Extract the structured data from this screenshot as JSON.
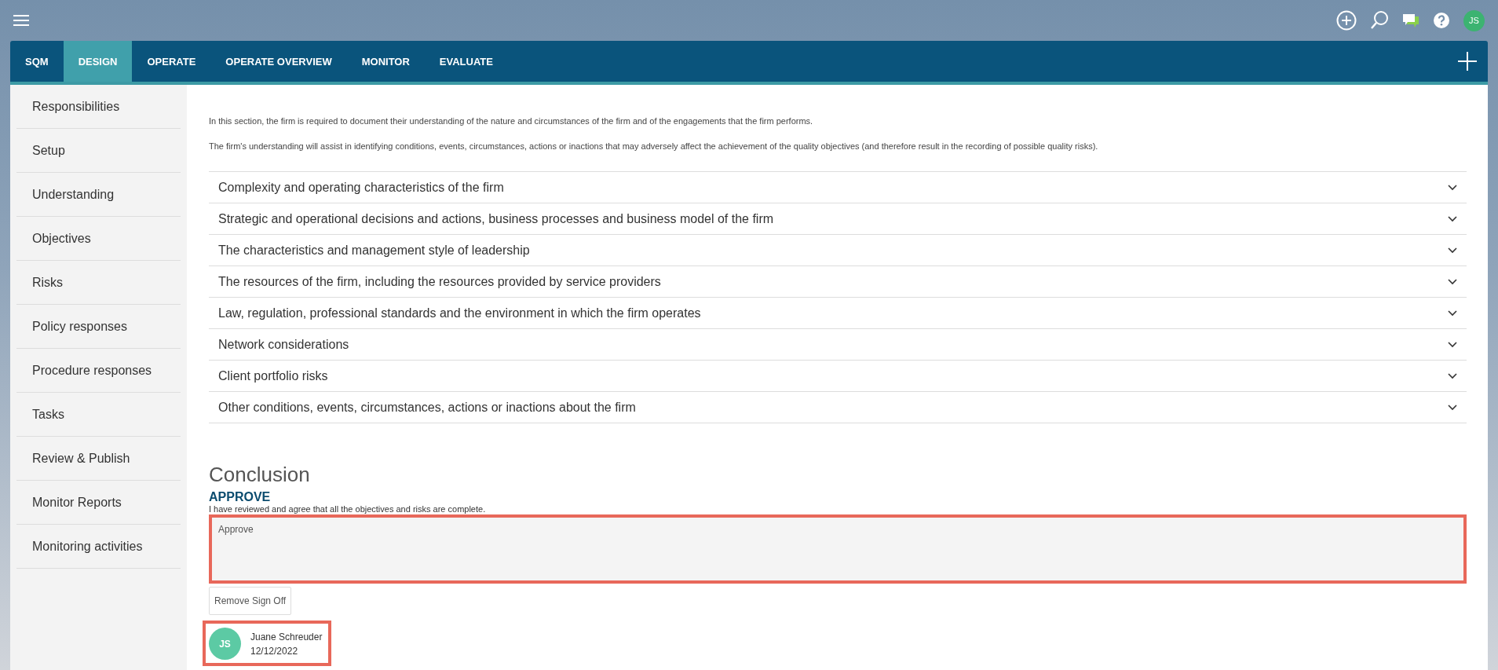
{
  "header": {
    "user_initials": "JS"
  },
  "tabs": [
    {
      "label": "SQM",
      "selected": false
    },
    {
      "label": "DESIGN",
      "selected": true
    },
    {
      "label": "OPERATE",
      "selected": false
    },
    {
      "label": "OPERATE OVERVIEW",
      "selected": false
    },
    {
      "label": "MONITOR",
      "selected": false
    },
    {
      "label": "EVALUATE",
      "selected": false
    }
  ],
  "sidebar": {
    "items": [
      "Responsibilities",
      "Setup",
      "Understanding",
      "Objectives",
      "Risks",
      "Policy responses",
      "Procedure responses",
      "Tasks",
      "Review & Publish",
      "Monitor Reports",
      "Monitoring activities"
    ]
  },
  "intro": [
    "In this section, the firm is required to document their understanding of the nature and circumstances of the firm and of the engagements that the firm performs.",
    "The firm's understanding will assist in identifying conditions, events, circumstances, actions or inactions that may adversely affect the achievement of the quality objectives (and therefore result in the recording of possible quality risks)."
  ],
  "sections": [
    {
      "title": "Complexity and operating characteristics of the firm",
      "expanded": false
    },
    {
      "title": "Strategic and operational decisions and actions, business processes and business model of the firm",
      "expanded": false
    },
    {
      "title": "The characteristics and management style of leadership",
      "expanded": false
    },
    {
      "title": "The resources of the firm, including the resources provided by service providers",
      "expanded": false
    },
    {
      "title": "Law, regulation, professional standards and the environment in which the firm operates",
      "expanded": false
    },
    {
      "title": "Network considerations",
      "expanded": false
    },
    {
      "title": "Client portfolio risks",
      "expanded": false
    },
    {
      "title": "Other conditions, events, circumstances, actions or inactions about the firm",
      "expanded": false
    }
  ],
  "conclusion": {
    "heading": "Conclusion",
    "label": "APPROVE",
    "description": "I have reviewed and agree that all the objectives and risks are complete.",
    "field_placeholder": "Approve",
    "button": "Remove Sign Off",
    "signer": {
      "initials": "JS",
      "name": "Juane Schreuder",
      "date": "12/12/2022"
    }
  }
}
